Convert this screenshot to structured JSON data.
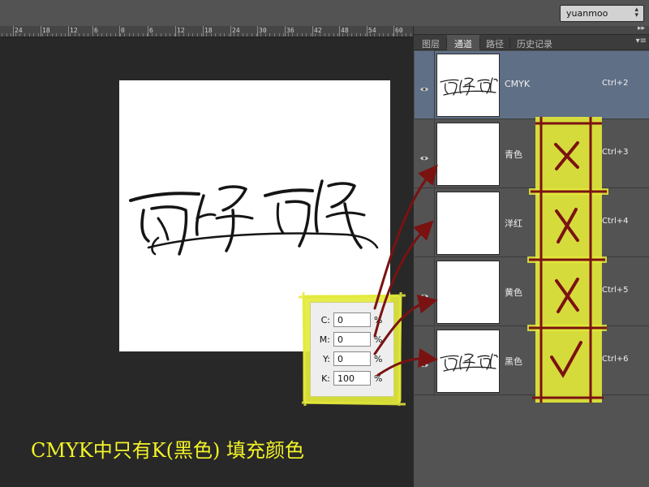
{
  "topbar": {
    "workspace": "yuanmoo",
    "workspace_arrow": "⇕"
  },
  "ruler": {
    "labels": [
      "24",
      "18",
      "12",
      "6",
      "0",
      "6",
      "12",
      "18",
      "24",
      "30",
      "36",
      "42",
      "48",
      "54",
      "60"
    ]
  },
  "cmyk": {
    "c": {
      "label": "C:",
      "value": "0",
      "unit": "%"
    },
    "m": {
      "label": "M:",
      "value": "0",
      "unit": "%"
    },
    "y": {
      "label": "Y:",
      "value": "0",
      "unit": "%"
    },
    "k": {
      "label": "K:",
      "value": "100",
      "unit": "%"
    }
  },
  "caption": "CMYK中只有K(黑色) 填充颜色",
  "panel": {
    "tabs": [
      "图层",
      "通道",
      "路径",
      "历史记录"
    ],
    "active_tab": "通道",
    "channels": [
      {
        "name": "CMYK",
        "shortcut": "Ctrl+2",
        "mark": ""
      },
      {
        "name": "青色",
        "shortcut": "Ctrl+3",
        "mark": "✗"
      },
      {
        "name": "洋红",
        "shortcut": "Ctrl+4",
        "mark": "✗"
      },
      {
        "name": "黄色",
        "shortcut": "Ctrl+5",
        "mark": "✗"
      },
      {
        "name": "黑色",
        "shortcut": "Ctrl+6",
        "mark": "✓"
      }
    ]
  },
  "colors": {
    "highlight": "#e4ea3a",
    "annotation": "#7a1212",
    "caption": "#f3f328",
    "selected_row": "#5f6f86"
  },
  "icons": [
    "eye-icon",
    "panel-menu-icon",
    "collapse-icon",
    "dropdown-arrow-icon"
  ]
}
